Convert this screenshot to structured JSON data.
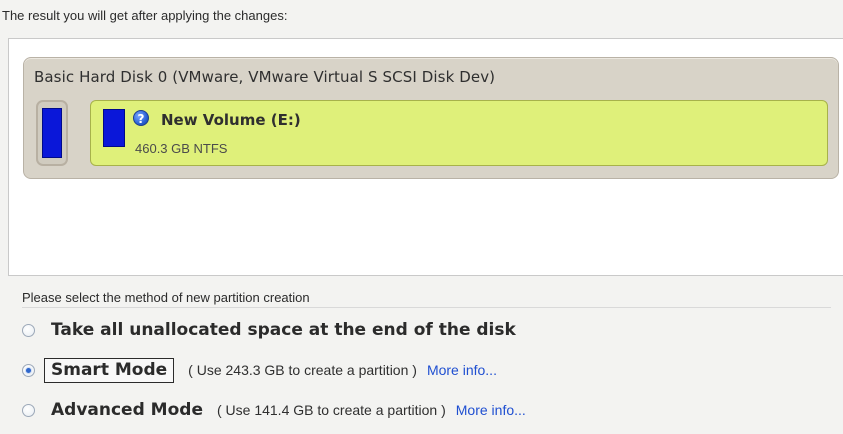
{
  "result": {
    "header": "The result you will get after applying the changes:"
  },
  "disk": {
    "title": "Basic Hard Disk 0 (VMware, VMware Virtual S SCSI Disk Dev)",
    "volume_name": "New Volume (E:)",
    "volume_meta": "460.3 GB NTFS",
    "volume_help_icon": "?"
  },
  "methods": {
    "header": "Please select the method of new partition creation",
    "options": [
      {
        "label": "Take all unallocated space at the end of the disk",
        "selected": false
      },
      {
        "label": "Smart Mode",
        "note": "( Use 243.3 GB to create a partition )",
        "link": "More info...",
        "selected": true
      },
      {
        "label": "Advanced Mode",
        "note": "( Use 141.4 GB to create a partition )",
        "link": "More info...",
        "selected": false
      }
    ]
  },
  "icons": {
    "disk": "disk-icon",
    "volume": "volume-icon",
    "help": "help-icon",
    "radio": "radio-button-icon"
  },
  "colors": {
    "disk_card": "#d8d3c8",
    "volume_card": "#dff07a",
    "disk_blue": "#0a17d9",
    "link": "#1f4fd1"
  }
}
